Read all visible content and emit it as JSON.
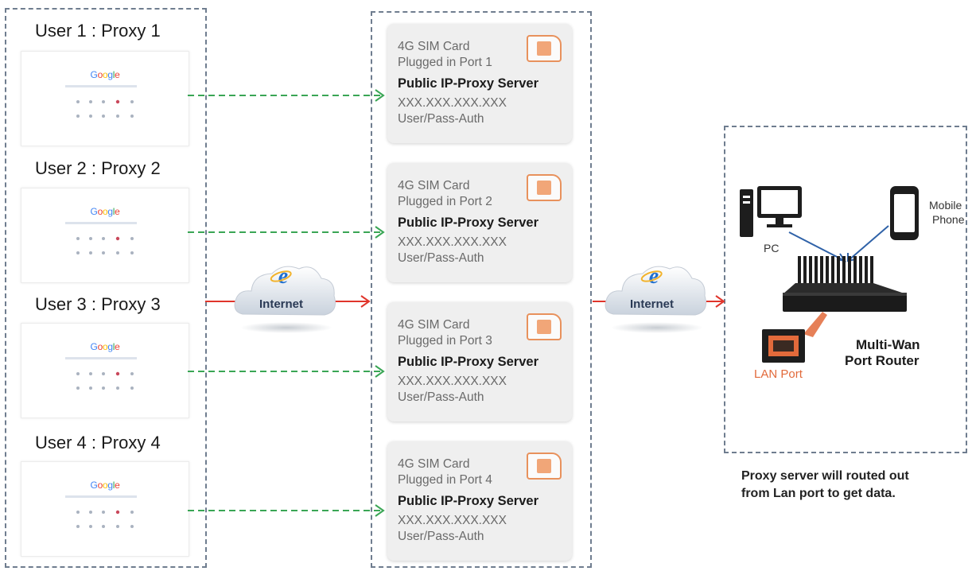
{
  "users": [
    {
      "label": "User 1 : Proxy 1",
      "logo": "Google"
    },
    {
      "label": "User 2 : Proxy 2",
      "logo": "Google"
    },
    {
      "label": "User 3 : Proxy 3",
      "logo": "Google"
    },
    {
      "label": "User 4 : Proxy 4",
      "logo": "Google"
    }
  ],
  "cards": [
    {
      "sim": "4G SIM Card",
      "port": "Plugged in Port 1",
      "server": "Public IP-Proxy Server",
      "ip": "XXX.XXX.XXX.XXX",
      "auth": "User/Pass-Auth"
    },
    {
      "sim": "4G SIM Card",
      "port": "Plugged in Port 2",
      "server": "Public IP-Proxy Server",
      "ip": "XXX.XXX.XXX.XXX",
      "auth": "User/Pass-Auth"
    },
    {
      "sim": "4G SIM Card",
      "port": "Plugged in Port 3",
      "server": "Public IP-Proxy Server",
      "ip": "XXX.XXX.XXX.XXX",
      "auth": "User/Pass-Auth"
    },
    {
      "sim": "4G SIM Card",
      "port": "Plugged in Port 4",
      "server": "Public IP-Proxy Server",
      "ip": "XXX.XXX.XXX.XXX",
      "auth": "User/Pass-Auth"
    }
  ],
  "clouds": [
    {
      "label": "Internet",
      "icon": "ie-icon"
    },
    {
      "label": "Internet",
      "icon": "ie-icon"
    }
  ],
  "router": {
    "pc_label": "PC",
    "mobile_label_1": "Mobile",
    "mobile_label_2": "Phone",
    "lan_label": "LAN Port",
    "router_label_1": "Multi-Wan",
    "router_label_2": "Port Router"
  },
  "note": {
    "line1": "Proxy server will routed out",
    "line2": "from Lan port to get data."
  },
  "colors": {
    "dashed_border": "#6f7d8f",
    "green_arrow": "#3aa655",
    "red_arrow": "#e0352b",
    "blue_line": "#2f62a8",
    "sim_orange": "#e8915c",
    "lan_orange": "#e26a3b"
  }
}
